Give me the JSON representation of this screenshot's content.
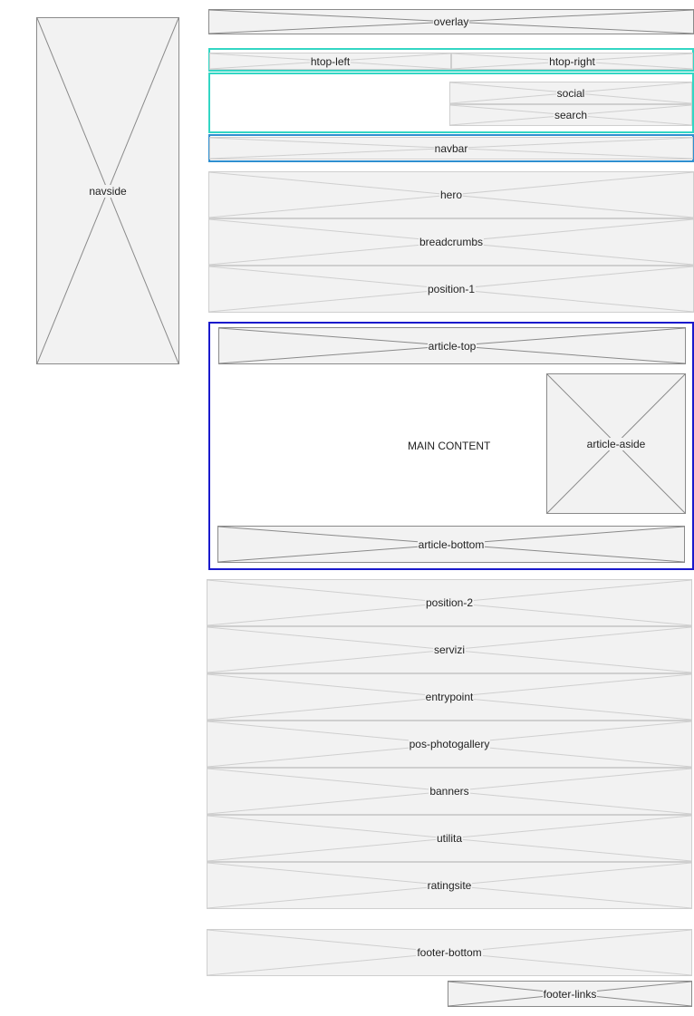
{
  "sidebar": {
    "navside": "navside"
  },
  "header": {
    "overlay": "overlay",
    "htop_left": "htop-left",
    "htop_right": "htop-right",
    "social": "social",
    "search": "search",
    "navbar": "navbar"
  },
  "top": {
    "hero": "hero",
    "breadcrumbs": "breadcrumbs",
    "position_1": "position-1"
  },
  "article": {
    "top": "article-top",
    "main": "MAIN CONTENT",
    "aside": "article-aside",
    "bottom": "article-bottom"
  },
  "lower": {
    "position_2": "position-2",
    "servizi": "servizi",
    "entrypoint": "entrypoint",
    "pos_photogallery": "pos-photogallery",
    "banners": "banners",
    "utilita": "utilita",
    "ratingsite": "ratingsite"
  },
  "footer": {
    "bottom": "footer-bottom",
    "links": "footer-links"
  },
  "colors": {
    "placeholder_fill": "#f2f2f2",
    "header_frame": "#33d6c4",
    "navbar_frame": "#2f8fd0",
    "article_frame": "#1a1acc"
  }
}
